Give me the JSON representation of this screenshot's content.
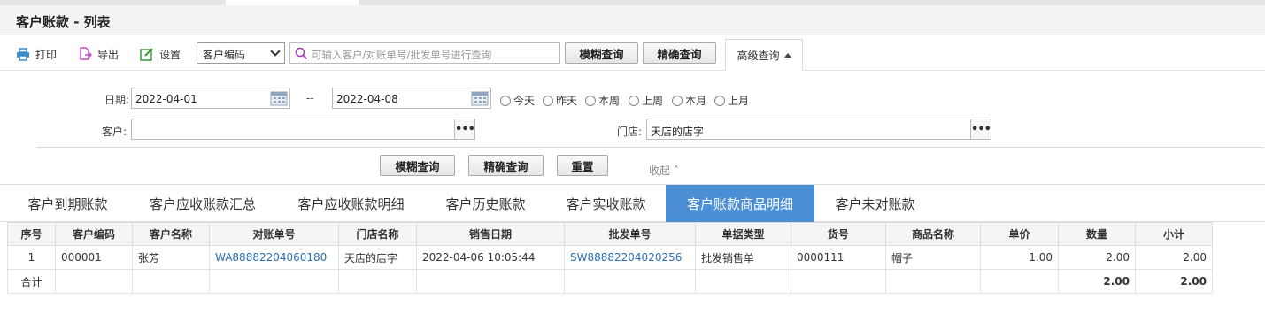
{
  "page": {
    "title": "客户账款 - 列表"
  },
  "toolbar": {
    "print_label": "打印",
    "export_label": "导出",
    "settings_label": "设置",
    "field_select": "客户编码",
    "search_placeholder": "可输入客户/对账单号/批发单号进行查询",
    "fuzzy_label": "模糊查询",
    "exact_label": "精确查询",
    "advanced_label": "高级查询"
  },
  "filters": {
    "date_label": "日期:",
    "date_from": "2022-04-01",
    "date_sep": "--",
    "date_to": "2022-04-08",
    "quick_ranges": [
      "今天",
      "昨天",
      "本周",
      "上周",
      "本月",
      "上月"
    ],
    "customer_label": "客户:",
    "customer_value": "",
    "store_label": "门店:",
    "store_value": "天店的店字",
    "fuzzy_label": "模糊查询",
    "exact_label": "精确查询",
    "reset_label": "重置",
    "collapse_label": "收起"
  },
  "tabs": [
    "客户到期账款",
    "客户应收账款汇总",
    "客户应收账款明细",
    "客户历史账款",
    "客户实收账款",
    "客户账款商品明细",
    "客户未对账款"
  ],
  "active_tab": "客户账款商品明细",
  "table": {
    "columns": [
      "序号",
      "客户编码",
      "客户名称",
      "对账单号",
      "门店名称",
      "销售日期",
      "批发单号",
      "单据类型",
      "货号",
      "商品名称",
      "单价",
      "数量",
      "小计"
    ],
    "rows": [
      [
        "1",
        "000001",
        "张芳",
        "WA88882204060180",
        "天店的店字",
        "2022-04-06 10:05:44",
        "SW88882204020256",
        "批发销售单",
        "0000111",
        "帽子",
        "1.00",
        "2.00",
        "2.00"
      ]
    ],
    "total_label": "合计",
    "total_qty": "2.00",
    "total_subtotal": "2.00"
  },
  "colors": {
    "accent": "#4a8fd6",
    "link": "#2b6fb3"
  }
}
